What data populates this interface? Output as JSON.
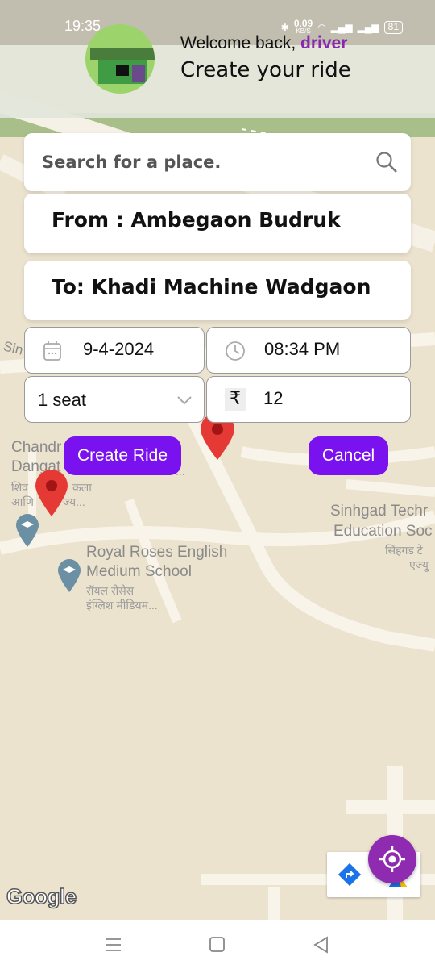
{
  "status_bar": {
    "time": "19:35",
    "net_speed": "0.09",
    "net_unit": "KB/S",
    "battery": "81"
  },
  "header": {
    "welcome_prefix": "Welcome back, ",
    "user_role": "driver",
    "title": "Create your ride"
  },
  "search": {
    "placeholder": "Search for a place.",
    "icon": "search-icon"
  },
  "route": {
    "from": "From : Ambegaon Budruk",
    "to": "To: Khadi Machine Wadgaon"
  },
  "ride": {
    "date": "9-4-2024",
    "time": "08:34 PM",
    "seats": "1 seat",
    "currency_symbol": "₹",
    "fare": "12"
  },
  "actions": {
    "create_label": "Create Ride",
    "cancel_label": "Cancel"
  },
  "map": {
    "labels": {
      "sin": "Sin",
      "chandr": "Chandr",
      "dangat": "Dangat",
      "shiv": "शिव",
      "kala": "कला",
      "aani": "आणि",
      "jya": "ज्य...",
      "dots": "...",
      "royal1": "Royal Roses English",
      "royal2": "Medium School",
      "royal_hi1": "रॉयल रोसेस",
      "royal_hi2": "इंग्लिश मीडियम...",
      "sinhgad1": "Sinhgad Techr",
      "sinhgad2": "Education Soc",
      "sinhgad_hi1": "सिंहगड टे",
      "sinhgad_hi2": "एज्यु"
    },
    "attribution": "Google"
  },
  "colors": {
    "accent": "#7a12f0",
    "brand_purple": "#8e2bb0",
    "pin_red": "#e53935"
  }
}
